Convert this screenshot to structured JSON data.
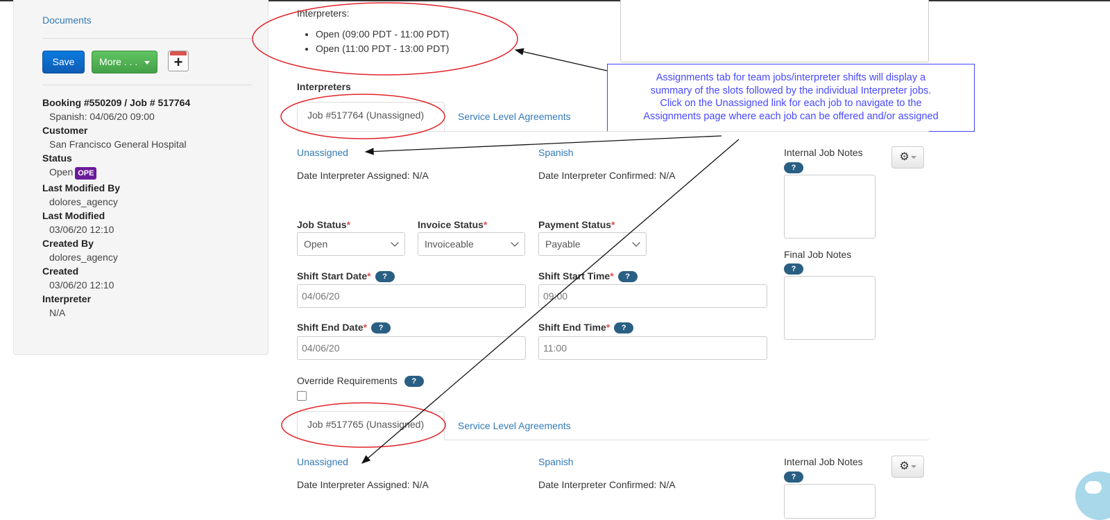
{
  "sidebar": {
    "documents_link": "Documents",
    "save_label": "Save",
    "more_label": "More . . .",
    "calendar_icon": "calendar-add-icon",
    "booking_title": "Booking #550209 / Job # 517764",
    "booking_subtitle": "Spanish: 04/06/20 09:00",
    "customer_label": "Customer",
    "customer_value": "San Francisco General Hospital",
    "status_label": "Status",
    "status_value": "Open",
    "status_badge": "OPE",
    "last_modified_by_label": "Last Modified By",
    "last_modified_by_value": "dolores_agency",
    "last_modified_label": "Last Modified",
    "last_modified_value": "03/06/20 12:10",
    "created_by_label": "Created By",
    "created_by_value": "dolores_agency",
    "created_label": "Created",
    "created_value": "03/06/20 12:10",
    "interpreter_label": "Interpreter",
    "interpreter_value": "N/A"
  },
  "summary": {
    "heading": "Interpreters:",
    "slots": [
      "Open (09:00 PDT - 11:00 PDT)",
      "Open (11:00 PDT - 13:00 PDT)"
    ]
  },
  "section_title": "Interpreters",
  "callout": {
    "line1": "Assignments tab for team jobs/interpreter shifts will display a",
    "line2": "summary of the slots followed by the individual Interpreter jobs.",
    "line3": "Click on the Unassigned link for each job to navigate to the",
    "line4": "Assignments page where each job can be offered and/or assigned"
  },
  "help_label": "?",
  "jobs": [
    {
      "tab_label": "Job #517764 (Unassigned)",
      "sla_tab": "Service Level Agreements",
      "assign_link": "Unassigned",
      "language_link": "Spanish",
      "date_assigned": "Date Interpreter Assigned: N/A",
      "date_confirmed": "Date Interpreter Confirmed: N/A",
      "internal_notes_label": "Internal Job Notes",
      "final_notes_label": "Final Job Notes",
      "job_status_label": "Job Status",
      "job_status_value": "Open",
      "invoice_status_label": "Invoice Status",
      "invoice_status_value": "Invoiceable",
      "payment_status_label": "Payment Status",
      "payment_status_value": "Payable",
      "shift_start_date_label": "Shift Start Date",
      "shift_start_date_value": "04/06/20",
      "shift_start_time_label": "Shift Start Time",
      "shift_start_time_value": "09:00",
      "shift_end_date_label": "Shift End Date",
      "shift_end_date_value": "04/06/20",
      "shift_end_time_label": "Shift End Time",
      "shift_end_time_value": "11:00",
      "override_label": "Override Requirements"
    },
    {
      "tab_label": "Job #517765 (Unassigned)",
      "sla_tab": "Service Level Agreements",
      "assign_link": "Unassigned",
      "language_link": "Spanish",
      "date_assigned": "Date Interpreter Assigned: N/A",
      "date_confirmed": "Date Interpreter Confirmed: N/A",
      "internal_notes_label": "Internal Job Notes"
    }
  ],
  "required_mark": "*"
}
